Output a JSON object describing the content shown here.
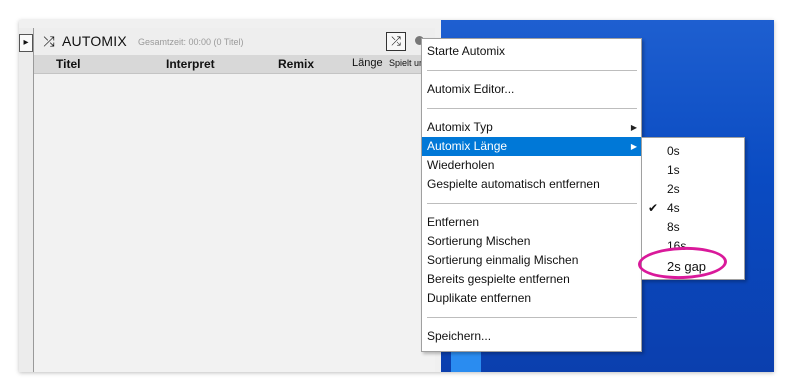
{
  "panel": {
    "title": "AUTOMIX",
    "info": "Gesamtzeit: 00:00 (0 Titel)",
    "shuffle_icon": "shuffle-icon",
    "columns": [
      "Titel",
      "Interpret",
      "Remix",
      "Länge",
      "Spielt um"
    ]
  },
  "menu": {
    "items": [
      {
        "label": "Starte Automix"
      },
      {
        "label": "Automix Editor..."
      },
      {
        "label": "Automix Typ",
        "submenu": true
      },
      {
        "label": "Automix Länge",
        "submenu": true,
        "highlighted": true
      },
      {
        "label": "Wiederholen"
      },
      {
        "label": "Gespielte automatisch entfernen"
      },
      {
        "label": "Entfernen"
      },
      {
        "label": "Sortierung Mischen"
      },
      {
        "label": "Sortierung einmalig Mischen"
      },
      {
        "label": "Bereits gespielte entfernen"
      },
      {
        "label": "Duplikate entfernen"
      },
      {
        "label": "Speichern..."
      }
    ]
  },
  "submenu": {
    "items": [
      {
        "label": "0s",
        "checked": false
      },
      {
        "label": "1s",
        "checked": false
      },
      {
        "label": "2s",
        "checked": false
      },
      {
        "label": "4s",
        "checked": true
      },
      {
        "label": "8s",
        "checked": false
      },
      {
        "label": "16s",
        "checked": false
      },
      {
        "label": "2s gap",
        "checked": false
      }
    ]
  },
  "colors": {
    "highlight": "#0078d7",
    "annotation": "#d9199a",
    "desktop": "#0a4bc2"
  }
}
